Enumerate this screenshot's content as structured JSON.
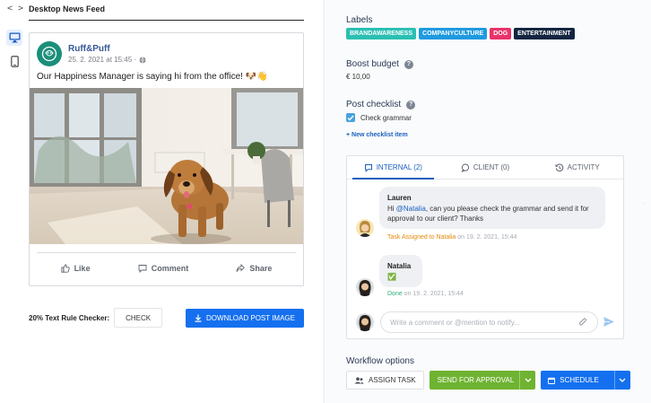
{
  "left": {
    "code_toggle": "< >",
    "feed_title": "Desktop News Feed",
    "post": {
      "page_name": "Ruff&Puff",
      "timestamp": "25. 2. 2021 at 15:45 ·",
      "text": "Our Happiness Manager is saying hi from the office! 🐶👋",
      "actions": [
        "Like",
        "Comment",
        "Share"
      ]
    },
    "checker_label": "20% Text Rule Checker:",
    "check_button": "CHECK",
    "download_button": "DOWNLOAD POST IMAGE"
  },
  "right": {
    "labels_title": "Labels",
    "labels": [
      {
        "text": "BRANDAWARENESS",
        "color": "#2bbfb3"
      },
      {
        "text": "COMPANYCULTURE",
        "color": "#1f9ae0"
      },
      {
        "text": "DOG",
        "color": "#e8336b"
      },
      {
        "text": "ENTERTAINMENT",
        "color": "#142541"
      }
    ],
    "boost_title": "Boost budget",
    "boost_value": "€ 10,00",
    "checklist_title": "Post checklist",
    "checklist_items": [
      "Check grammar"
    ],
    "new_checklist": "+ New checklist item",
    "tabs": [
      "INTERNAL (2)",
      "CLIENT (0)",
      "ACTIVITY"
    ],
    "messages": [
      {
        "author": "Lauren",
        "text_prefix": "Hi ",
        "mention": "@Natalia",
        "text_suffix": ", can you please check the grammar and send it for approval to our client? Thanks",
        "meta_status": "Task Assigned to Natalia",
        "meta_time": " on 19. 2. 2021, 15:44"
      },
      {
        "author": "Natalia",
        "text": "✅",
        "meta_status": "Done",
        "meta_time": " on 19. 2. 2021, 15:44"
      }
    ],
    "comment_placeholder": "Write a comment or @mention to notify...",
    "workflow_title": "Workflow options",
    "assign_task": "ASSIGN TASK",
    "send_for_approval": "SEND FOR APPROVAL",
    "schedule": "SCHEDULE"
  }
}
